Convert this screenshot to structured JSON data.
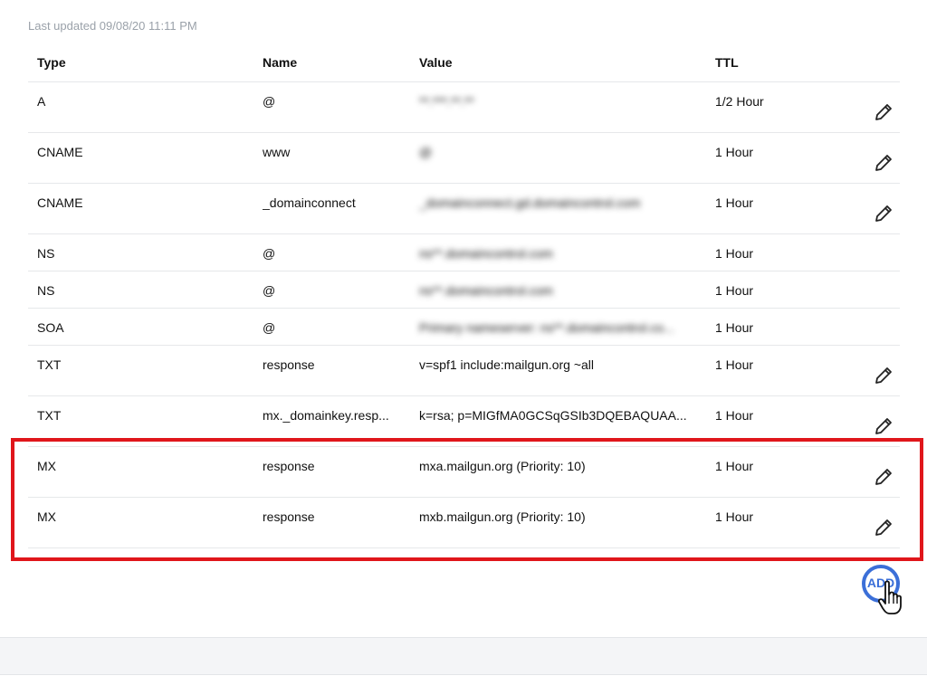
{
  "last_updated": "Last updated 09/08/20 11:11 PM",
  "table": {
    "headers": {
      "type": "Type",
      "name": "Name",
      "value": "Value",
      "ttl": "TTL"
    },
    "rows": [
      {
        "type": "A",
        "name": "@",
        "value": "**.***.**.**",
        "ttl": "1/2 Hour",
        "editable": true,
        "value_blurred": true
      },
      {
        "type": "CNAME",
        "name": "www",
        "value": "@",
        "ttl": "1 Hour",
        "editable": true,
        "value_blurred": true
      },
      {
        "type": "CNAME",
        "name": "_domainconnect",
        "value": "_domainconnect.gd.domaincontrol.com",
        "ttl": "1 Hour",
        "editable": true,
        "value_blurred": true
      },
      {
        "type": "NS",
        "name": "@",
        "value": "ns**.domaincontrol.com",
        "ttl": "1 Hour",
        "editable": false,
        "value_blurred": true
      },
      {
        "type": "NS",
        "name": "@",
        "value": "ns**.domaincontrol.com",
        "ttl": "1 Hour",
        "editable": false,
        "value_blurred": true
      },
      {
        "type": "SOA",
        "name": "@",
        "value": "Primary nameserver: ns**.domaincontrol.co...",
        "ttl": "1 Hour",
        "editable": false,
        "value_blurred": true
      },
      {
        "type": "TXT",
        "name": "response",
        "value": "v=spf1 include:mailgun.org ~all",
        "ttl": "1 Hour",
        "editable": true,
        "value_blurred": false
      },
      {
        "type": "TXT",
        "name": "mx._domainkey.resp...",
        "value": "k=rsa; p=MIGfMA0GCSqGSIb3DQEBAQUAA...",
        "ttl": "1 Hour",
        "editable": true,
        "value_blurred": false
      },
      {
        "type": "MX",
        "name": "response",
        "value": "mxa.mailgun.org (Priority: 10)",
        "ttl": "1 Hour",
        "editable": true,
        "value_blurred": false
      },
      {
        "type": "MX",
        "name": "response",
        "value": "mxb.mailgun.org (Priority: 10)",
        "ttl": "1 Hour",
        "editable": true,
        "value_blurred": false
      }
    ]
  },
  "add_button": {
    "label": "ADD"
  },
  "icons": {
    "edit": "pencil-icon",
    "cursor": "hand-pointer-icon"
  },
  "colors": {
    "highlight": "#e0161b",
    "accent": "#3b6fd8",
    "muted_text": "#9aa1a9"
  }
}
